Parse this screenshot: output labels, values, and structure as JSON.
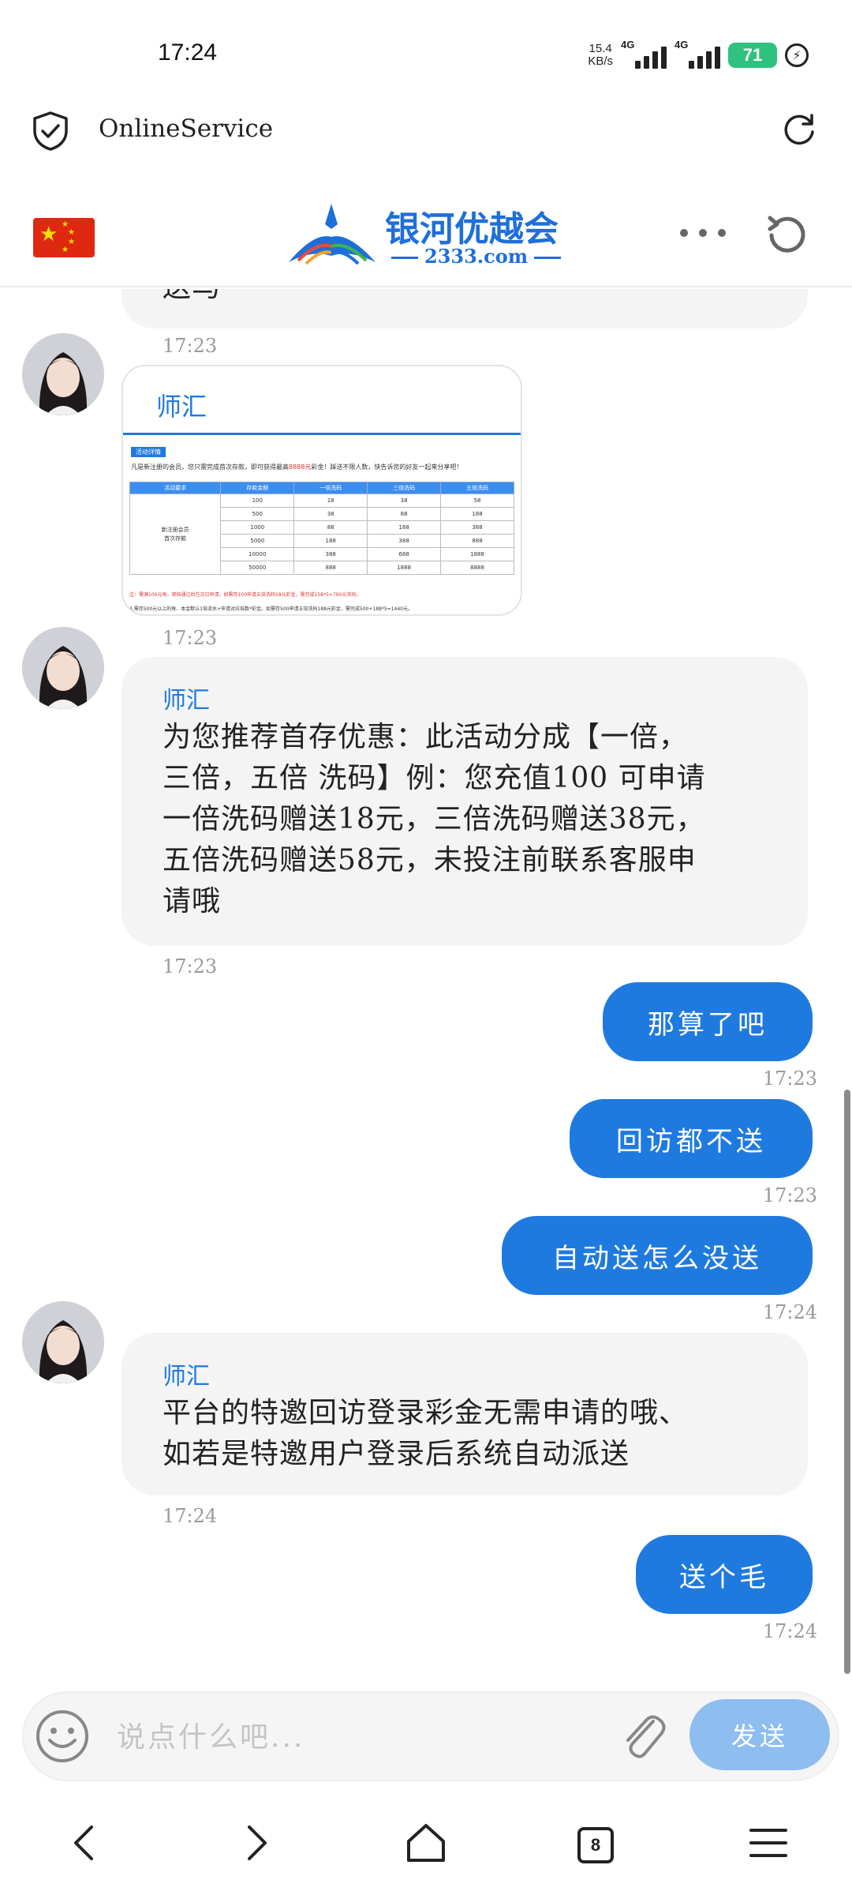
{
  "status_bar": {
    "time": "17:24",
    "net_speed_value": "15.4",
    "net_speed_unit": "KB/s",
    "signal1_label": "4G",
    "signal2_label": "4G",
    "battery": "71"
  },
  "browser": {
    "title": "OnlineService"
  },
  "header": {
    "logo_text": "银河优越会",
    "logo_sub": "2333.com"
  },
  "messages": {
    "partial_text": "送马",
    "t0": "17:23",
    "image_card": {
      "sender": "师汇",
      "banner": "活动详情",
      "intro_a": "凡是新注册的会员，您只需完成首次存款，即可获得最高",
      "intro_highlight": "8888元",
      "intro_b": "彩金！踩送不限人数，快告诉您的好友一起来分享吧！",
      "columns": [
        "活动要求",
        "存款金额",
        "一倍洗码",
        "三倍洗码",
        "五倍洗码"
      ],
      "group_label_1": "新注册会员",
      "group_label_2": "首次存款",
      "rows": [
        [
          "100",
          "18",
          "38",
          "58"
        ],
        [
          "500",
          "38",
          "88",
          "188"
        ],
        [
          "1000",
          "88",
          "188",
          "388"
        ],
        [
          "5000",
          "188",
          "388",
          "888"
        ],
        [
          "10000",
          "388",
          "688",
          "1888"
        ],
        [
          "50000",
          "888",
          "1888",
          "8888"
        ]
      ],
      "note_red": "注：需满100元每，审核通过后在次日申请，如需存100申请五倍洗码58元彩金，需完成158*5=790元洗码。",
      "note_black": "3.需存500元以上的每、本金默认1倍流水+申请对应倍数*彩金。如需存500申请五倍洗码188元彩金，需完成500+188*5=1440元。",
      "time": "17:23"
    },
    "msg1": {
      "sender": "师汇",
      "lines": [
        "为您推荐首存优惠：此活动分成【一倍，",
        "三倍，五倍 洗码】例：您充值100 可申请",
        "一倍洗码赠送18元，三倍洗码赠送38元，",
        "五倍洗码赠送58元，未投注前联系客服申",
        "请哦"
      ],
      "time": "17:23"
    },
    "out1": {
      "text": "那算了吧",
      "time": "17:23"
    },
    "out2": {
      "text": "回访都不送",
      "time": "17:23"
    },
    "out3": {
      "text": "自动送怎么没送",
      "time": "17:24"
    },
    "msg2": {
      "sender": "师汇",
      "lines": [
        "平台的特邀回访登录彩金无需申请的哦、",
        "如若是特邀用户登录后系统自动派送"
      ],
      "time": "17:24"
    },
    "out4": {
      "text": "送个毛",
      "time": "17:24"
    }
  },
  "input": {
    "placeholder": "说点什么吧...",
    "send_label": "发送"
  },
  "nav": {
    "tab_count": "8"
  },
  "colors": {
    "accent": "#1f7ae0",
    "send_disabled": "#8ebdf0",
    "battery": "#2ec27e"
  }
}
